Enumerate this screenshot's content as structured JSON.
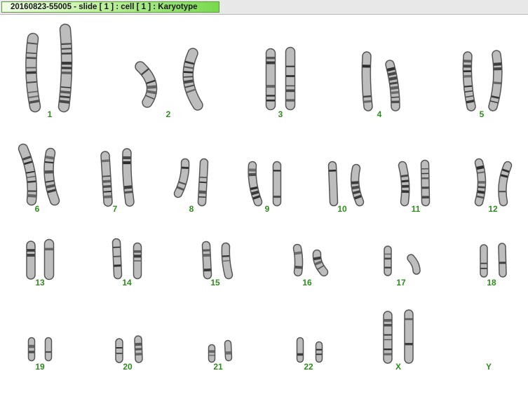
{
  "window": {
    "title": "20160823-55005 - slide [ 1 ] : cell [ 1 ] : Karyotype"
  },
  "karyotype": {
    "label_color": "#2e8b1e",
    "pairs": [
      {
        "label": "1"
      },
      {
        "label": "2"
      },
      {
        "label": "3"
      },
      {
        "label": "4"
      },
      {
        "label": "5"
      },
      {
        "label": "6"
      },
      {
        "label": "7"
      },
      {
        "label": "8"
      },
      {
        "label": "9"
      },
      {
        "label": "10"
      },
      {
        "label": "11"
      },
      {
        "label": "12"
      },
      {
        "label": "13"
      },
      {
        "label": "14"
      },
      {
        "label": "15"
      },
      {
        "label": "16"
      },
      {
        "label": "17"
      },
      {
        "label": "18"
      },
      {
        "label": "19"
      },
      {
        "label": "20"
      },
      {
        "label": "21"
      },
      {
        "label": "22"
      },
      {
        "label": "X"
      },
      {
        "label": "Y"
      }
    ]
  }
}
